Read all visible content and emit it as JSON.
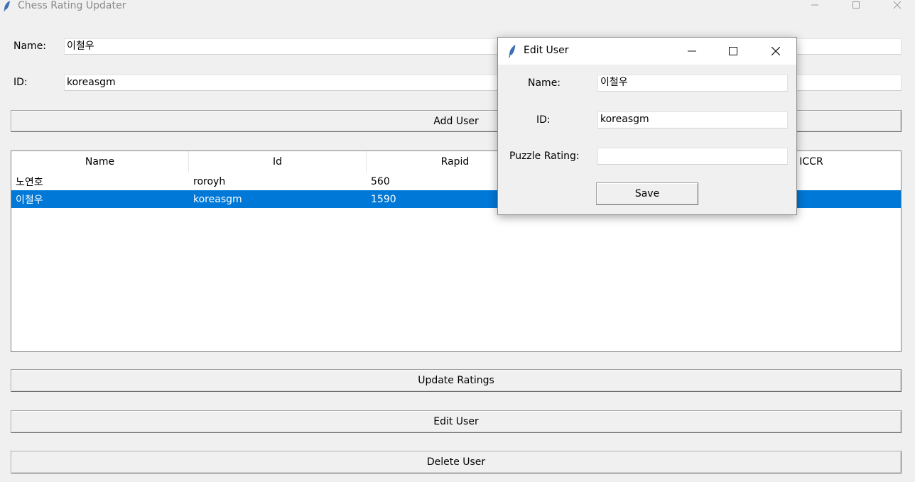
{
  "window": {
    "title": "Chess Rating Updater",
    "controls": {
      "minimize": "—",
      "maximize": "☐",
      "close": "✕"
    }
  },
  "form": {
    "name_label": "Name:",
    "name_value": "이철우",
    "id_label": "ID:",
    "id_value": "koreasgm",
    "add_button": "Add User"
  },
  "table": {
    "columns": [
      "Name",
      "Id",
      "Rapid",
      "",
      "ICCR"
    ],
    "rows": [
      {
        "name": "노연호",
        "id": "roroyh",
        "rapid": "560",
        "selected": false
      },
      {
        "name": "이철우",
        "id": "koreasgm",
        "rapid": "1590",
        "selected": true
      }
    ],
    "selection_color": "#0078d7"
  },
  "actions": {
    "update": "Update Ratings",
    "edit": "Edit User",
    "delete": "Delete User"
  },
  "dialog": {
    "title": "Edit User",
    "name_label": "Name:",
    "name_value": "이철우",
    "id_label": "ID:",
    "id_value": "koreasgm",
    "puzzle_label": "Puzzle Rating:",
    "puzzle_value": "",
    "save_button": "Save",
    "controls": {
      "minimize": "—",
      "maximize": "☐",
      "close": "✕"
    }
  },
  "icons": {
    "app": "feather-icon"
  }
}
